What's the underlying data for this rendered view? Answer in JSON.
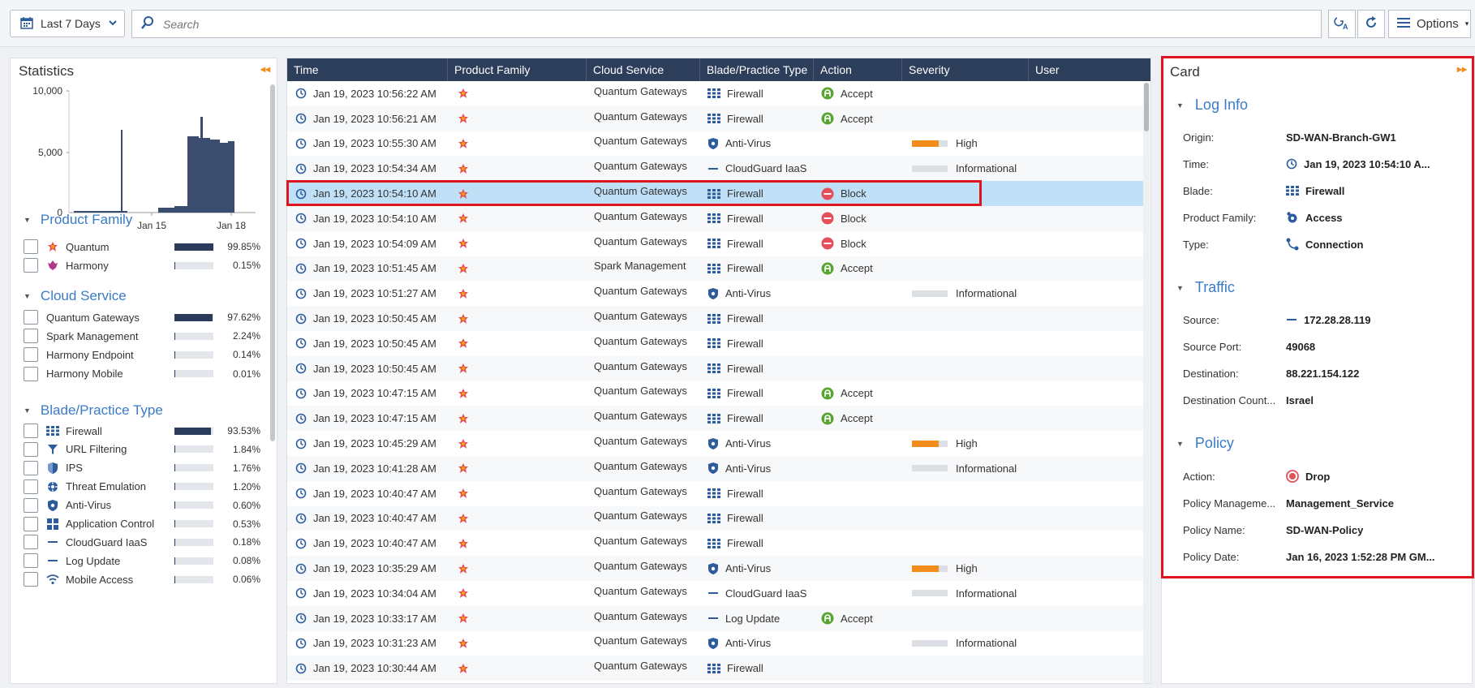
{
  "toolbar": {
    "date_range": "Last 7 Days",
    "search_placeholder": "Search",
    "options_label": "Options"
  },
  "statistics": {
    "title": "Statistics",
    "histogram": {
      "y_ticks": [
        "10,000",
        "5,000",
        "0"
      ],
      "x_ticks": [
        "Jan 15",
        "Jan 18"
      ]
    },
    "sections": [
      {
        "title": "Product Family",
        "items": [
          {
            "label": "Quantum",
            "percent": "99.85%",
            "value": 99.85,
            "icon": "quantum-icon"
          },
          {
            "label": "Harmony",
            "percent": "0.15%",
            "value": 0.15,
            "icon": "harmony-icon"
          }
        ]
      },
      {
        "title": "Cloud Service",
        "items": [
          {
            "label": "Quantum Gateways",
            "percent": "97.62%",
            "value": 97.62
          },
          {
            "label": "Spark Management",
            "percent": "2.24%",
            "value": 2.24
          },
          {
            "label": "Harmony Endpoint",
            "percent": "0.14%",
            "value": 0.14
          },
          {
            "label": "Harmony Mobile",
            "percent": "0.01%",
            "value": 0.01
          }
        ]
      },
      {
        "title": "Blade/Practice Type",
        "items": [
          {
            "label": "Firewall",
            "percent": "93.53%",
            "value": 93.53,
            "icon": "firewall-icon"
          },
          {
            "label": "URL Filtering",
            "percent": "1.84%",
            "value": 1.84,
            "icon": "url-filtering-icon"
          },
          {
            "label": "IPS",
            "percent": "1.76%",
            "value": 1.76,
            "icon": "ips-icon"
          },
          {
            "label": "Threat Emulation",
            "percent": "1.20%",
            "value": 1.2,
            "icon": "threat-emulation-icon"
          },
          {
            "label": "Anti-Virus",
            "percent": "0.60%",
            "value": 0.6,
            "icon": "anti-virus-icon"
          },
          {
            "label": "Application Control",
            "percent": "0.53%",
            "value": 0.53,
            "icon": "application-control-icon"
          },
          {
            "label": "CloudGuard IaaS",
            "percent": "0.18%",
            "value": 0.18,
            "icon": "dash-icon"
          },
          {
            "label": "Log Update",
            "percent": "0.08%",
            "value": 0.08,
            "icon": "dash-icon"
          },
          {
            "label": "Mobile Access",
            "percent": "0.06%",
            "value": 0.06,
            "icon": "mobile-access-icon"
          }
        ]
      }
    ]
  },
  "logs": {
    "columns": [
      "Time",
      "Product Family",
      "Cloud Service",
      "Blade/Practice Type",
      "Action",
      "Severity",
      "User"
    ],
    "rows": [
      {
        "time": "Jan 19, 2023 10:56:22 AM",
        "service": "Quantum Gateways",
        "blade": "Firewall",
        "action": "Accept",
        "severity": ""
      },
      {
        "time": "Jan 19, 2023 10:56:21 AM",
        "service": "Quantum Gateways",
        "blade": "Firewall",
        "action": "Accept",
        "severity": ""
      },
      {
        "time": "Jan 19, 2023 10:55:30 AM",
        "service": "Quantum Gateways",
        "blade": "Anti-Virus",
        "action": "",
        "severity": "High"
      },
      {
        "time": "Jan 19, 2023 10:54:34 AM",
        "service": "Quantum Gateways",
        "blade": "CloudGuard IaaS",
        "action": "",
        "severity": "Informational"
      },
      {
        "time": "Jan 19, 2023 10:54:10 AM",
        "service": "Quantum Gateways",
        "blade": "Firewall",
        "action": "Block",
        "severity": "",
        "selected": true
      },
      {
        "time": "Jan 19, 2023 10:54:10 AM",
        "service": "Quantum Gateways",
        "blade": "Firewall",
        "action": "Block",
        "severity": ""
      },
      {
        "time": "Jan 19, 2023 10:54:09 AM",
        "service": "Quantum Gateways",
        "blade": "Firewall",
        "action": "Block",
        "severity": ""
      },
      {
        "time": "Jan 19, 2023 10:51:45 AM",
        "service": "Spark Management",
        "blade": "Firewall",
        "action": "Accept",
        "severity": ""
      },
      {
        "time": "Jan 19, 2023 10:51:27 AM",
        "service": "Quantum Gateways",
        "blade": "Anti-Virus",
        "action": "",
        "severity": "Informational"
      },
      {
        "time": "Jan 19, 2023 10:50:45 AM",
        "service": "Quantum Gateways",
        "blade": "Firewall",
        "action": "",
        "severity": ""
      },
      {
        "time": "Jan 19, 2023 10:50:45 AM",
        "service": "Quantum Gateways",
        "blade": "Firewall",
        "action": "",
        "severity": ""
      },
      {
        "time": "Jan 19, 2023 10:50:45 AM",
        "service": "Quantum Gateways",
        "blade": "Firewall",
        "action": "",
        "severity": ""
      },
      {
        "time": "Jan 19, 2023 10:47:15 AM",
        "service": "Quantum Gateways",
        "blade": "Firewall",
        "action": "Accept",
        "severity": ""
      },
      {
        "time": "Jan 19, 2023 10:47:15 AM",
        "service": "Quantum Gateways",
        "blade": "Firewall",
        "action": "Accept",
        "severity": ""
      },
      {
        "time": "Jan 19, 2023 10:45:29 AM",
        "service": "Quantum Gateways",
        "blade": "Anti-Virus",
        "action": "",
        "severity": "High"
      },
      {
        "time": "Jan 19, 2023 10:41:28 AM",
        "service": "Quantum Gateways",
        "blade": "Anti-Virus",
        "action": "",
        "severity": "Informational"
      },
      {
        "time": "Jan 19, 2023 10:40:47 AM",
        "service": "Quantum Gateways",
        "blade": "Firewall",
        "action": "",
        "severity": ""
      },
      {
        "time": "Jan 19, 2023 10:40:47 AM",
        "service": "Quantum Gateways",
        "blade": "Firewall",
        "action": "",
        "severity": ""
      },
      {
        "time": "Jan 19, 2023 10:40:47 AM",
        "service": "Quantum Gateways",
        "blade": "Firewall",
        "action": "",
        "severity": ""
      },
      {
        "time": "Jan 19, 2023 10:35:29 AM",
        "service": "Quantum Gateways",
        "blade": "Anti-Virus",
        "action": "",
        "severity": "High"
      },
      {
        "time": "Jan 19, 2023 10:34:04 AM",
        "service": "Quantum Gateways",
        "blade": "CloudGuard IaaS",
        "action": "",
        "severity": "Informational"
      },
      {
        "time": "Jan 19, 2023 10:33:17 AM",
        "service": "Quantum Gateways",
        "blade": "Log Update",
        "action": "Accept",
        "severity": ""
      },
      {
        "time": "Jan 19, 2023 10:31:23 AM",
        "service": "Quantum Gateways",
        "blade": "Anti-Virus",
        "action": "",
        "severity": "Informational"
      },
      {
        "time": "Jan 19, 2023 10:30:44 AM",
        "service": "Quantum Gateways",
        "blade": "Firewall",
        "action": "",
        "severity": ""
      }
    ]
  },
  "card": {
    "title": "Card",
    "sections": [
      {
        "title": "Log Info",
        "fields": [
          {
            "key": "Origin:",
            "value": "SD-WAN-Branch-GW1",
            "icon": ""
          },
          {
            "key": "Time:",
            "value": "Jan 19, 2023 10:54:10 A...",
            "icon": "clock-icon"
          },
          {
            "key": "Blade:",
            "value": "Firewall",
            "icon": "firewall-icon"
          },
          {
            "key": "Product Family:",
            "value": "Access",
            "icon": "access-icon"
          },
          {
            "key": "Type:",
            "value": "Connection",
            "icon": "connection-icon"
          }
        ]
      },
      {
        "title": "Traffic",
        "fields": [
          {
            "key": "Source:",
            "value": "172.28.28.119",
            "icon": "dash-icon"
          },
          {
            "key": "Source Port:",
            "value": "49068",
            "icon": ""
          },
          {
            "key": "Destination:",
            "value": "88.221.154.122",
            "icon": ""
          },
          {
            "key": "Destination Count...",
            "value": "Israel",
            "icon": ""
          }
        ]
      },
      {
        "title": "Policy",
        "fields": [
          {
            "key": "Action:",
            "value": "Drop",
            "icon": "drop-icon"
          },
          {
            "key": "Policy Manageme...",
            "value": "Management_Service",
            "icon": ""
          },
          {
            "key": "Policy Name:",
            "value": "SD-WAN-Policy",
            "icon": ""
          },
          {
            "key": "Policy Date:",
            "value": "Jan 16, 2023 1:52:28 PM GM...",
            "icon": ""
          }
        ]
      }
    ]
  },
  "colors": {
    "header_bg": "#2d3e5b",
    "accent_blue": "#3a7bc8",
    "selected_row": "#bfe0f7",
    "highlight_red": "#e0141e",
    "accept_green": "#5aa532",
    "block_red": "#e4505a",
    "severity_orange": "#f28c1a"
  }
}
